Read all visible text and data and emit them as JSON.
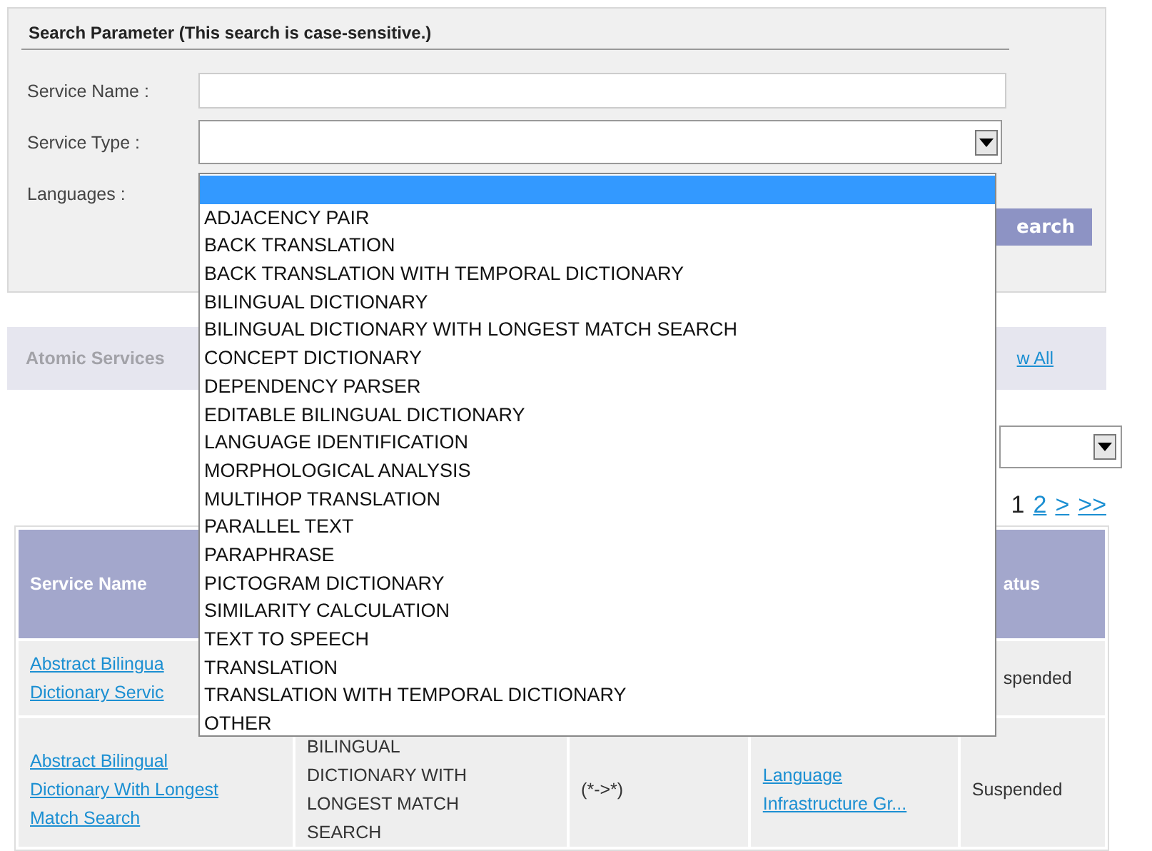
{
  "search_panel": {
    "title": "Search Parameter (This search is case-sensitive.)",
    "fields": [
      {
        "label": "Service Name :",
        "kind": "text"
      },
      {
        "label": "Service Type :",
        "kind": "select"
      },
      {
        "label": "Languages :",
        "kind": "covered"
      }
    ],
    "search_button": "earch"
  },
  "service_type_dropdown": {
    "options": [
      {
        "selected": true
      },
      {
        "label": "ADJACENCY PAIR",
        "selected": false
      },
      {
        "label": "BACK TRANSLATION",
        "selected": false
      },
      {
        "label": "BACK TRANSLATION WITH TEMPORAL DICTIONARY",
        "selected": false
      },
      {
        "label": "BILINGUAL DICTIONARY",
        "selected": false
      },
      {
        "label": "BILINGUAL DICTIONARY WITH LONGEST MATCH SEARCH",
        "selected": false
      },
      {
        "label": "CONCEPT DICTIONARY",
        "selected": false
      },
      {
        "label": "DEPENDENCY PARSER",
        "selected": false
      },
      {
        "label": "EDITABLE BILINGUAL DICTIONARY",
        "selected": false
      },
      {
        "label": "LANGUAGE IDENTIFICATION",
        "selected": false
      },
      {
        "label": "MORPHOLOGICAL ANALYSIS",
        "selected": false
      },
      {
        "label": "MULTIHOP TRANSLATION",
        "selected": false
      },
      {
        "label": "PARALLEL TEXT",
        "selected": false
      },
      {
        "label": "PARAPHRASE",
        "selected": false
      },
      {
        "label": "PICTOGRAM DICTIONARY",
        "selected": false
      },
      {
        "label": "SIMILARITY CALCULATION",
        "selected": false
      },
      {
        "label": "TEXT TO SPEECH",
        "selected": false
      },
      {
        "label": "TRANSLATION",
        "selected": false
      },
      {
        "label": "TRANSLATION WITH TEMPORAL DICTIONARY",
        "selected": false
      },
      {
        "label": "OTHER",
        "selected": false
      }
    ]
  },
  "services_bar": {
    "title": "Atomic Services",
    "link": "w All"
  },
  "pager": [
    {
      "label": "1",
      "current": true
    },
    {
      "label": "2",
      "current": false
    },
    {
      "label": ">",
      "current": false
    },
    {
      "label": ">>",
      "current": false
    }
  ],
  "table": {
    "columns": [
      {
        "label": "Service Name"
      },
      {},
      {},
      {},
      {
        "label": "atus"
      }
    ],
    "rows": [
      {
        "cells": [
          {
            "kind": "link",
            "lines": [
              "Abstract Bilingua",
              "Dictionary Servic"
            ]
          },
          null,
          null,
          null,
          {
            "kind": "text",
            "lines": [
              "spended"
            ]
          }
        ]
      },
      {
        "cells": [
          {
            "kind": "link",
            "lines": [
              "Abstract Bilingual",
              "Dictionary With Longest",
              "Match Search"
            ]
          },
          {
            "kind": "text",
            "lines": [
              "BILINGUAL",
              "DICTIONARY WITH",
              "LONGEST MATCH",
              "SEARCH"
            ]
          },
          {
            "kind": "text",
            "lines": [
              "(*->*)"
            ]
          },
          {
            "kind": "link",
            "lines": [
              "Language",
              "Infrastructure Gr..."
            ]
          },
          {
            "kind": "text",
            "lines": [
              "Suspended"
            ]
          }
        ]
      }
    ]
  }
}
